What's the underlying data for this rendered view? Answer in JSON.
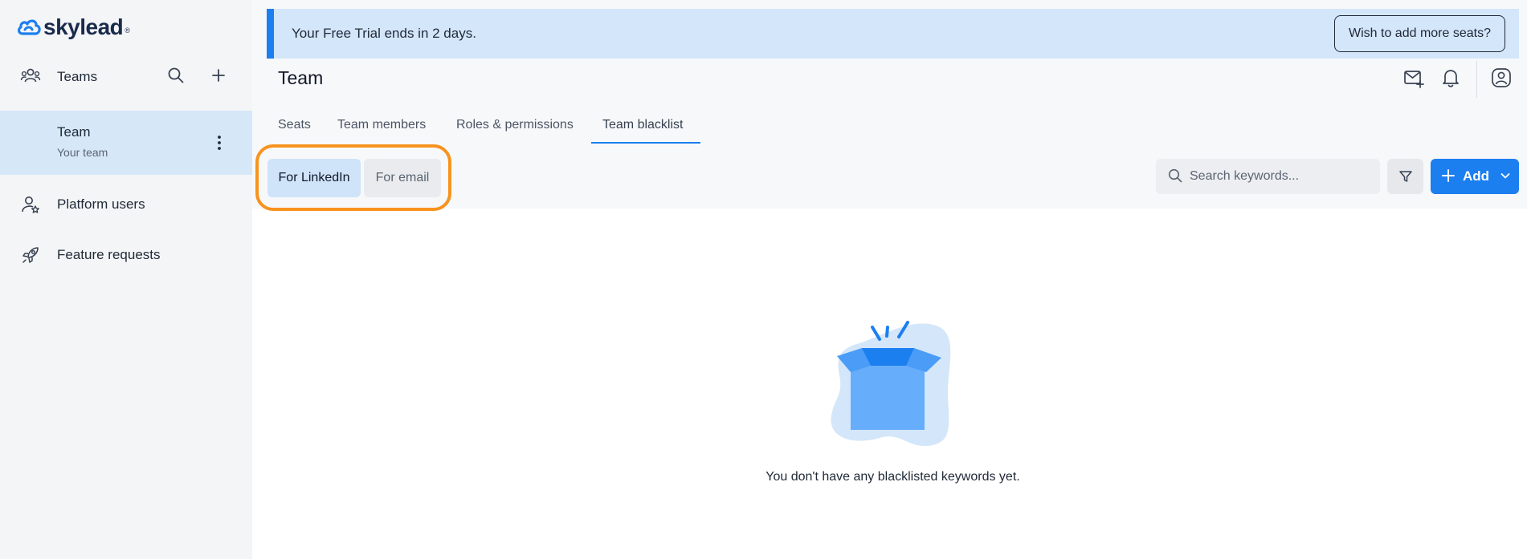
{
  "app": {
    "logo_text": "skylead",
    "logo_mark": "®"
  },
  "sidebar": {
    "teams_label": "Teams",
    "team_item": {
      "name": "Team",
      "subtitle": "Your team"
    },
    "items": [
      {
        "label": "Platform users",
        "icon": "user-star-icon"
      },
      {
        "label": "Feature requests",
        "icon": "rocket-icon"
      }
    ]
  },
  "banner": {
    "message": "Your Free Trial ends in 2 days.",
    "cta_label": "Wish to add more seats?"
  },
  "header": {
    "title": "Team"
  },
  "tabs": [
    {
      "label": "Seats",
      "active": false
    },
    {
      "label": "Team members",
      "active": false
    },
    {
      "label": "Roles & permissions",
      "active": false
    },
    {
      "label": "Team blacklist",
      "active": true
    }
  ],
  "segment": {
    "linkedin_label": "For LinkedIn",
    "email_label": "For email",
    "selected": "For LinkedIn"
  },
  "toolbar": {
    "search_placeholder": "Search keywords...",
    "add_label": "Add"
  },
  "empty_state": {
    "message": "You don't have any blacklisted keywords yet."
  },
  "colors": {
    "accent": "#1b7ff0",
    "banner_bg": "#d4e6fa",
    "highlight": "#f7931e",
    "selected_bg": "#d6e7f8"
  }
}
